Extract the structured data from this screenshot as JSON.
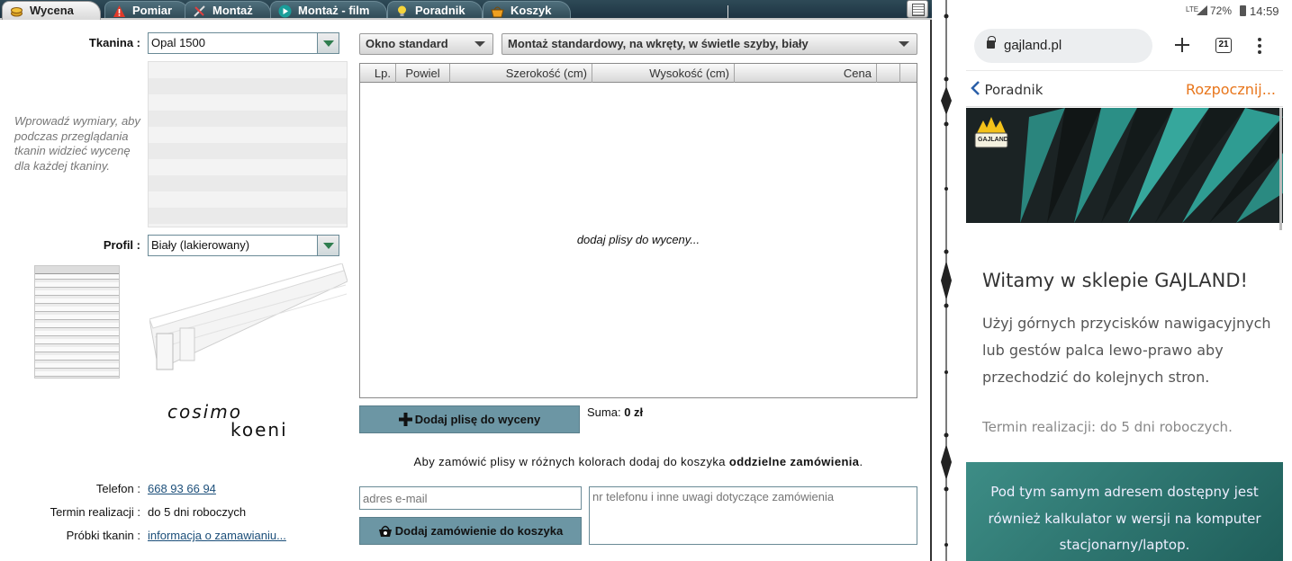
{
  "tabs": [
    {
      "label": "Wycena",
      "icon": "coins-icon",
      "active": true
    },
    {
      "label": "Pomiar",
      "icon": "warning-icon"
    },
    {
      "label": "Montaż",
      "icon": "tools-icon"
    },
    {
      "label": "Montaż - film",
      "icon": "play-icon"
    },
    {
      "label": "Poradnik",
      "icon": "lightbulb-icon"
    },
    {
      "label": "Koszyk",
      "icon": "basket-icon"
    }
  ],
  "left": {
    "fabric_label": "Tkanina",
    "fabric_value": "Opal 1500",
    "hint": "Wprowadź wymiary, aby podczas przeglądania tkanin widzieć wycenę dla każdej tkaniny.",
    "profile_label": "Profil",
    "profile_value": "Biały (lakierowany)",
    "brand_line1": "cosimo",
    "brand_line2": "koeni",
    "phone_label": "Telefon",
    "phone_value": "668 93 66 94",
    "term_label": "Termin realizacji",
    "term_value": "do 5 dni roboczych",
    "samples_label": "Próbki tkanin",
    "samples_value": "informacja o zamawianiu..."
  },
  "main": {
    "window_type": "Okno standard",
    "mount_type": "Montaż standardowy, na wkręty, w świetle szyby, biały",
    "columns": {
      "lp": "Lp.",
      "powiel": "Powiel",
      "szer": "Szerokość (cm)",
      "wys": "Wysokość (cm)",
      "cena": "Cena"
    },
    "empty_text": "dodaj plisy do wyceny...",
    "add_button": "Dodaj plisę do wyceny",
    "sum_label": "Suma:",
    "sum_value": "0 zł",
    "note_text": "Aby zamówić plisy w różnych kolorach dodaj do koszyka",
    "note_bold": "oddzielne zamówienia",
    "email_placeholder": "adres e-mail",
    "notes_placeholder": "nr telefonu i inne uwagi dotyczące zamówienia",
    "cart_button": "Dodaj zamówienie do koszyka"
  },
  "phone": {
    "signal": "LTE",
    "battery": "72%",
    "time": "14:59",
    "url": "gajland.pl",
    "tab_count": "21",
    "back_label": "Poradnik",
    "start_label": "Rozpocznij...",
    "logo_text": "GAJLAND",
    "welcome": "Witamy w sklepie GAJLAND!",
    "paragraph": "Użyj górnych przycisków nawigacyjnych lub gestów palca lewo-prawo aby przechodzić do kolejnych stron.",
    "term": "Termin realizacji: do 5 dni roboczych.",
    "teal_text": "Pod tym samym adresem dostępny jest również kalkulator w wersji na komputer stacjonarny/laptop."
  },
  "colors": {
    "tab_bg": "#2d4753",
    "button": "#6c96a4",
    "accent_orange": "#e8761c",
    "link": "#1c4f7a",
    "teal": "#2e7a73"
  }
}
